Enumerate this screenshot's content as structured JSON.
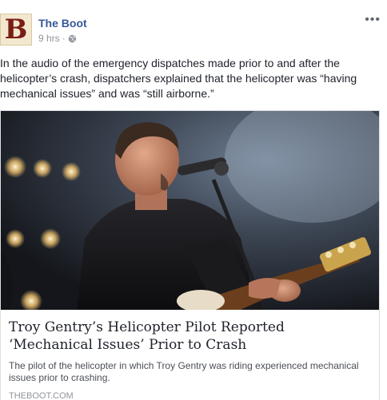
{
  "post": {
    "page_name": "The Boot",
    "avatar_letter": "B",
    "timestamp": "9 hrs",
    "separator": "·",
    "privacy_icon": "globe-icon",
    "more_icon": "ellipsis-icon",
    "more_label": "•••",
    "text": "In the audio of the emergency dispatches made prior to and after the helicopter’s crash, dispatchers explained that the helicopter was “having mechanical issues” and was “still airborne.”"
  },
  "link_card": {
    "image": "singer-with-guitar-and-microphone",
    "title": "Troy Gentry’s Helicopter Pilot Reported ‘Mechanical Issues’ Prior to Crash",
    "description": "The pilot of the helicopter in which Troy Gentry was riding experienced mechanical issues prior to crashing.",
    "domain": "THEBOOT.COM"
  },
  "colors": {
    "link_blue": "#365899",
    "meta_gray": "#90949c",
    "avatar_red": "#7a1d14"
  }
}
